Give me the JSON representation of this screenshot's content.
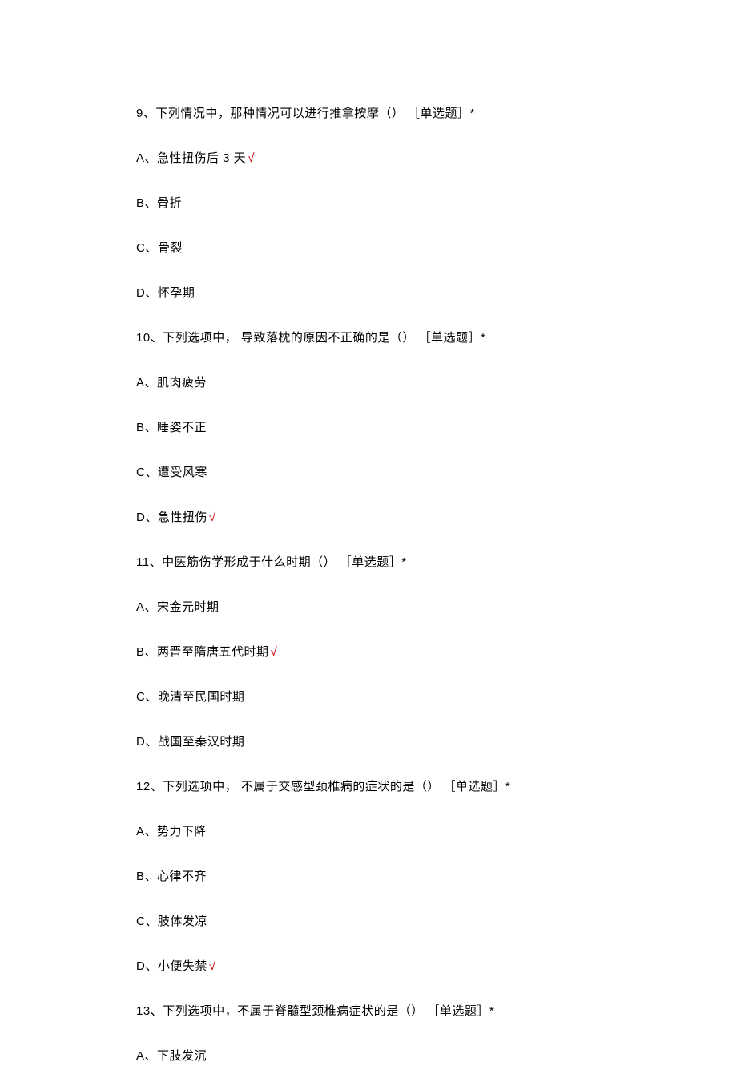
{
  "questions": [
    {
      "number": "9、",
      "text": "下列情况中，那种情况可以进行推拿按摩（） ［单选题］*",
      "options": [
        {
          "label": "A、急性扭伤后 3 天",
          "correct": true
        },
        {
          "label": "B、骨折",
          "correct": false
        },
        {
          "label": "C、骨裂",
          "correct": false
        },
        {
          "label": "D、怀孕期",
          "correct": false
        }
      ]
    },
    {
      "number": "10、",
      "text": "下列选项中， 导致落枕的原因不正确的是（） ［单选题］*",
      "options": [
        {
          "label": "A、肌肉疲劳",
          "correct": false
        },
        {
          "label": "B、睡姿不正",
          "correct": false
        },
        {
          "label": "C、遭受风寒",
          "correct": false
        },
        {
          "label": "D、急性扭伤",
          "correct": true
        }
      ]
    },
    {
      "number": "11、",
      "text": "中医筋伤学形成于什么时期（） ［单选题］*",
      "options": [
        {
          "label": "A、宋金元时期",
          "correct": false
        },
        {
          "label": "B、两晋至隋唐五代时期",
          "correct": true
        },
        {
          "label": "C、晚清至民国时期",
          "correct": false
        },
        {
          "label": "D、战国至秦汉时期",
          "correct": false
        }
      ]
    },
    {
      "number": "12、",
      "text": "下列选项中， 不属于交感型颈椎病的症状的是（） ［单选题］*",
      "options": [
        {
          "label": "A、势力下降",
          "correct": false
        },
        {
          "label": "B、心律不齐",
          "correct": false
        },
        {
          "label": "C、肢体发凉",
          "correct": false
        },
        {
          "label": "D、小便失禁",
          "correct": true
        }
      ]
    },
    {
      "number": "13、",
      "text": "下列选项中，不属于脊髓型颈椎病症状的是（） ［单选题］*",
      "options": [
        {
          "label": "A、下肢发沉",
          "correct": false
        }
      ]
    }
  ],
  "checkMark": "√"
}
